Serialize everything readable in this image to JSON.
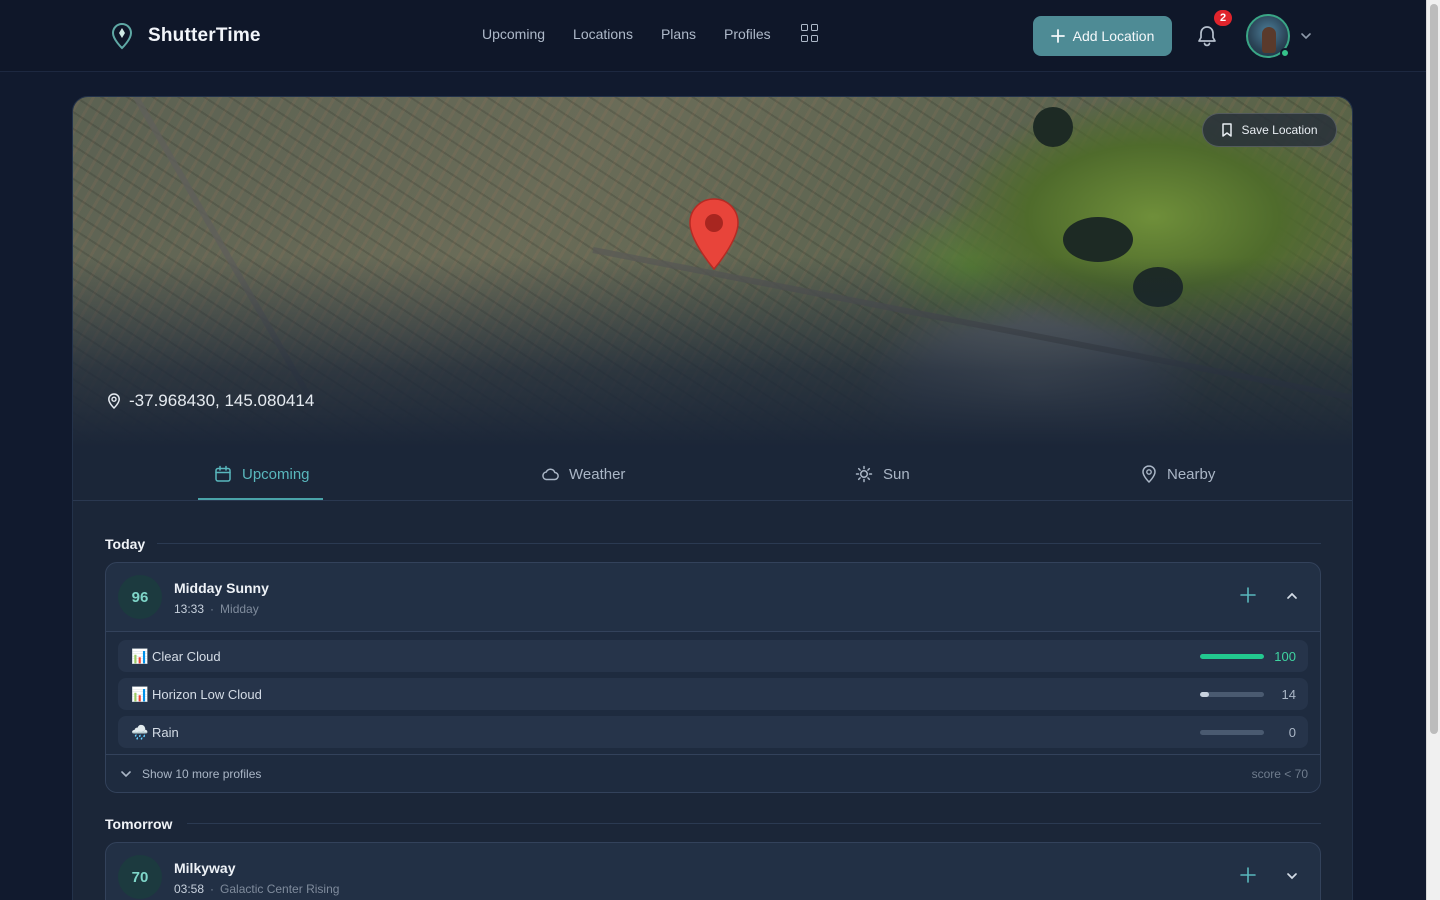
{
  "app": {
    "name": "ShutterTime"
  },
  "nav": {
    "items": [
      "Upcoming",
      "Locations",
      "Plans",
      "Profiles"
    ]
  },
  "header": {
    "add_location_label": "Add Location",
    "notification_count": "2"
  },
  "map": {
    "save_location_label": "Save Location",
    "coordinates": "-37.968430, 145.080414"
  },
  "tabs": [
    {
      "label": "Upcoming",
      "icon": "calendar-icon",
      "active": true
    },
    {
      "label": "Weather",
      "icon": "cloud-icon",
      "active": false
    },
    {
      "label": "Sun",
      "icon": "sun-icon",
      "active": false
    },
    {
      "label": "Nearby",
      "icon": "location-pin-icon",
      "active": false
    }
  ],
  "sections": {
    "today": {
      "title": "Today",
      "event": {
        "score": "96",
        "title": "Midday Sunny",
        "time": "13:33",
        "subtitle": "Midday",
        "profiles": [
          {
            "icon": "📊",
            "label": "Clear Cloud",
            "value": "100",
            "level": 1.0,
            "color": "#22c98f"
          },
          {
            "icon": "📊",
            "label": "Horizon Low Cloud",
            "value": "14",
            "level": 0.14,
            "color": "#c8d2de"
          },
          {
            "icon": "🌧️",
            "label": "Rain",
            "value": "0",
            "level": 0.0,
            "color": "#c8d2de"
          }
        ],
        "show_more_label": "Show 10 more profiles",
        "score_note": "score < 70"
      }
    },
    "tomorrow": {
      "title": "Tomorrow",
      "event": {
        "score": "70",
        "title": "Milkyway",
        "time": "03:58",
        "subtitle": "Galactic Center Rising"
      }
    }
  },
  "colors": {
    "accent": "#4e8b95",
    "active_tab": "#59b7bd",
    "pin": "#e8443a",
    "badge": "#e0242c"
  }
}
